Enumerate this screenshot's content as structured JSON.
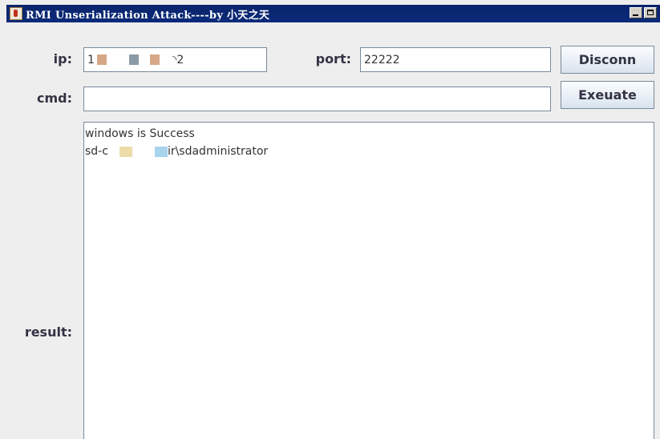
{
  "window": {
    "title": "RMI Unserialization Attack----by 小天之天"
  },
  "form": {
    "ip_label": "ip:",
    "ip_value_start": "1",
    "ip_value_end": "2",
    "port_label": "port:",
    "port_value": "22222",
    "cmd_label": "cmd:",
    "cmd_value": "",
    "result_label": "result:"
  },
  "buttons": {
    "disconnect_label": "Disconn",
    "execute_label": "Exeuate"
  },
  "result": {
    "line1": "windows is Success",
    "line2_start": "sd-c",
    "line2_end": "ir\\sdadministrator"
  },
  "colors": {
    "titlebar": "#0a246a",
    "background": "#eeeeee",
    "label": "#333344",
    "field_border": "#7a8a99"
  }
}
